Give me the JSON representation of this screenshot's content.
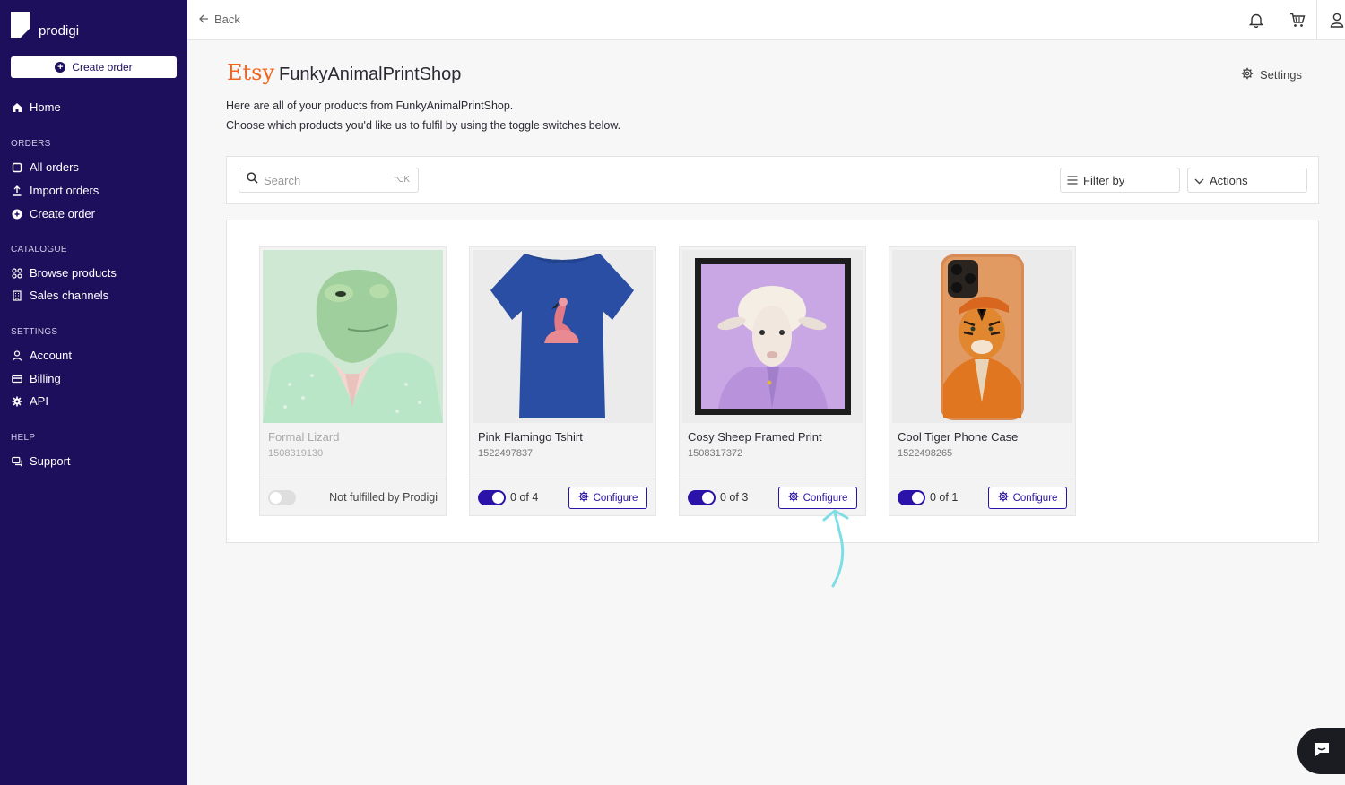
{
  "brand": {
    "name": "prodigi"
  },
  "sidebar": {
    "create_order_label": "Create order",
    "home_label": "Home",
    "sections": {
      "orders": "ORDERS",
      "catalogue": "CATALOGUE",
      "settings": "SETTINGS",
      "help": "HELP"
    },
    "orders_items": [
      {
        "label": "All orders",
        "icon": "square-icon"
      },
      {
        "label": "Import orders",
        "icon": "upload-icon"
      },
      {
        "label": "Create order",
        "icon": "plus-circle-icon"
      }
    ],
    "catalogue_items": [
      {
        "label": "Browse products",
        "icon": "grid-icon"
      },
      {
        "label": "Sales channels",
        "icon": "building-icon"
      }
    ],
    "settings_items": [
      {
        "label": "Account",
        "icon": "user-icon"
      },
      {
        "label": "Billing",
        "icon": "card-icon"
      },
      {
        "label": "API",
        "icon": "gear-icon"
      }
    ],
    "help_items": [
      {
        "label": "Support",
        "icon": "chat-icon"
      }
    ]
  },
  "topbar": {
    "back_label": "Back"
  },
  "header": {
    "channel_logo": "Etsy",
    "shop_name": "FunkyAnimalPrintShop",
    "settings_label": "Settings",
    "description_line1": "Here are all of your products from FunkyAnimalPrintShop.",
    "description_line2": "Choose which products you'd like us to fulfil by using the toggle switches below."
  },
  "toolbar": {
    "search_placeholder": "Search",
    "search_shortcut": "⌥K",
    "filter_label": "Filter by",
    "actions_label": "Actions"
  },
  "products": [
    {
      "title": "Formal Lizard",
      "sku": "1508319130",
      "fulfilled": false,
      "status": "Not fulfilled by Prodigi"
    },
    {
      "title": "Pink Flamingo Tshirt",
      "sku": "1522497837",
      "fulfilled": true,
      "count": "0 of 4",
      "configure": "Configure"
    },
    {
      "title": "Cosy Sheep Framed Print",
      "sku": "1508317372",
      "fulfilled": true,
      "count": "0 of 3",
      "configure": "Configure"
    },
    {
      "title": "Cool Tiger Phone Case",
      "sku": "1522498265",
      "fulfilled": true,
      "count": "0 of 1",
      "configure": "Configure"
    }
  ],
  "colors": {
    "sidebar": "#1e0f5c",
    "accent": "#2b12a8",
    "etsy": "#f1641e",
    "annotation_arrow": "#7fdde6"
  }
}
